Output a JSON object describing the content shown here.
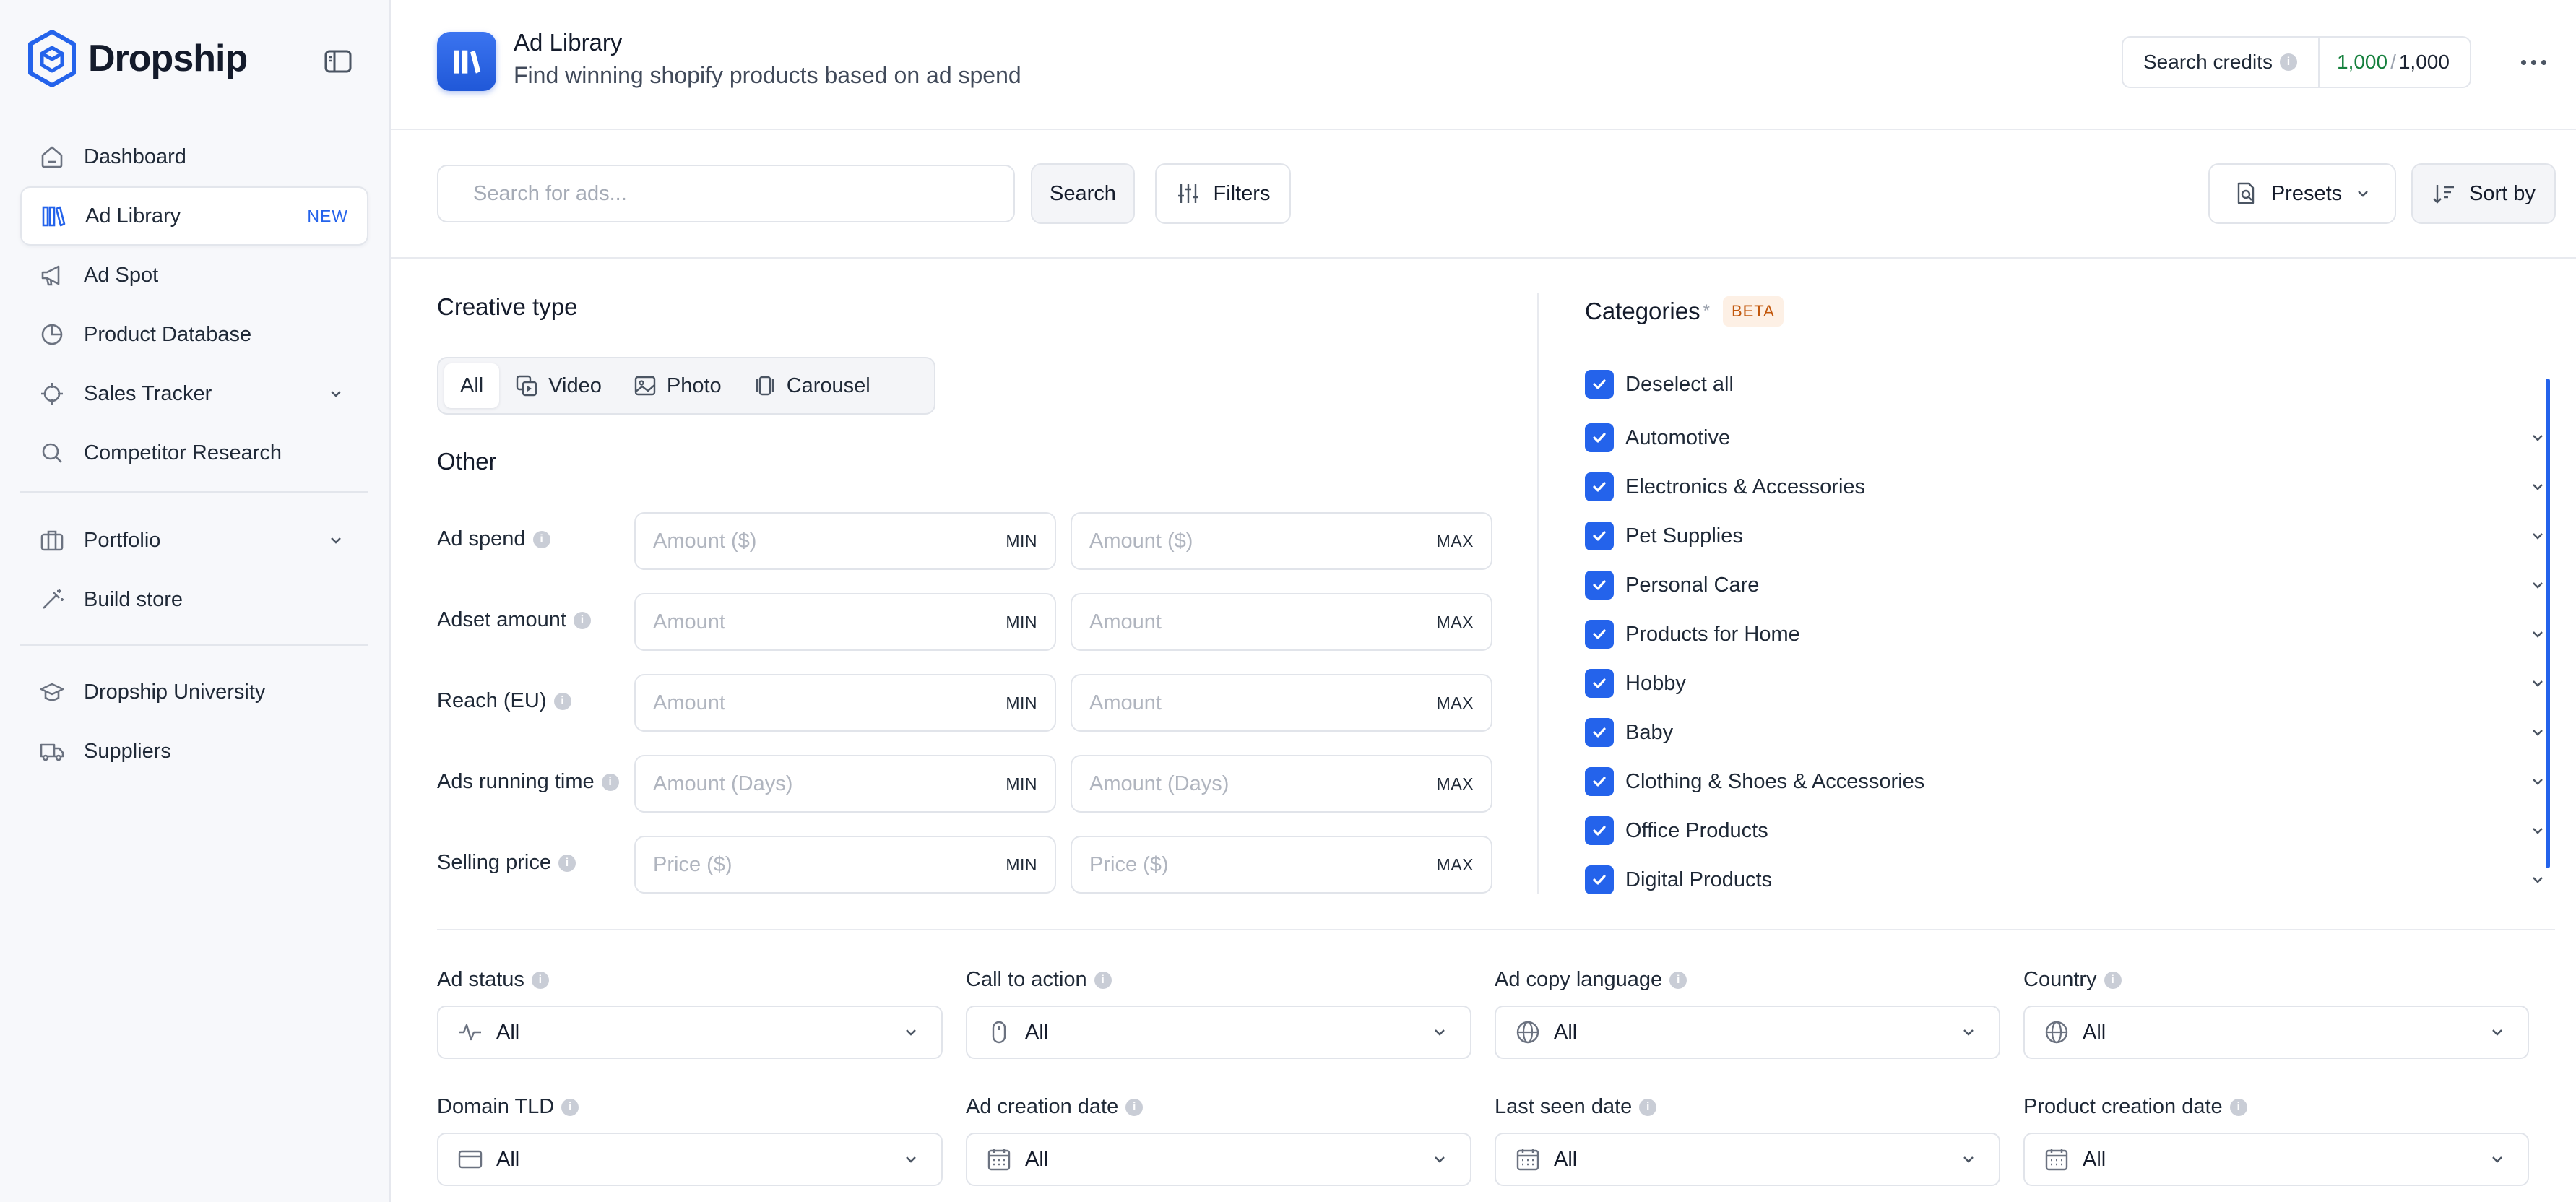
{
  "brand": {
    "name": "Dropship"
  },
  "sidebar": {
    "items": [
      {
        "label": "Dashboard",
        "icon": "home-icon"
      },
      {
        "label": "Ad Library",
        "icon": "library-icon",
        "badge": "NEW",
        "active": true
      },
      {
        "label": "Ad Spot",
        "icon": "megaphone-icon"
      },
      {
        "label": "Product Database",
        "icon": "pie-chart-icon"
      },
      {
        "label": "Sales Tracker",
        "icon": "crosshair-icon",
        "expandable": true
      },
      {
        "label": "Competitor Research",
        "icon": "search-icon"
      },
      {
        "label": "Portfolio",
        "icon": "briefcase-icon",
        "expandable": true
      },
      {
        "label": "Build store",
        "icon": "wand-icon"
      },
      {
        "label": "Dropship University",
        "icon": "graduation-cap-icon"
      },
      {
        "label": "Suppliers",
        "icon": "truck-icon"
      }
    ]
  },
  "header": {
    "title": "Ad Library",
    "subtitle": "Find winning shopify products based on ad spend",
    "credits_label": "Search credits",
    "credits_used": "1,000",
    "credits_total": "1,000"
  },
  "toolbar": {
    "search_placeholder": "Search for ads...",
    "search_label": "Search",
    "filters_label": "Filters",
    "presets_label": "Presets",
    "sort_label": "Sort by"
  },
  "creative": {
    "title": "Creative type",
    "options": [
      {
        "label": "All",
        "active": true
      },
      {
        "label": "Video",
        "icon": "video-icon"
      },
      {
        "label": "Photo",
        "icon": "image-icon"
      },
      {
        "label": "Carousel",
        "icon": "carousel-icon"
      }
    ]
  },
  "other": {
    "title": "Other",
    "min_tag": "MIN",
    "max_tag": "MAX",
    "ranges": [
      {
        "label": "Ad spend",
        "placeholder": "Amount ($)"
      },
      {
        "label": "Adset amount",
        "placeholder": "Amount"
      },
      {
        "label": "Reach (EU)",
        "placeholder": "Amount"
      },
      {
        "label": "Ads running time",
        "placeholder": "Amount (Days)"
      },
      {
        "label": "Selling price",
        "placeholder": "Price ($)"
      }
    ]
  },
  "categories": {
    "title": "Categories",
    "required_mark": "*",
    "badge": "BETA",
    "deselect_label": "Deselect all",
    "items": [
      "Automotive",
      "Electronics & Accessories",
      "Pet Supplies",
      "Personal Care",
      "Products for Home",
      "Hobby",
      "Baby",
      "Clothing & Shoes & Accessories",
      "Office Products",
      "Digital Products"
    ]
  },
  "dropdowns": [
    {
      "label": "Ad status",
      "value": "All",
      "icon": "activity-icon"
    },
    {
      "label": "Call to action",
      "value": "All",
      "icon": "mouse-icon"
    },
    {
      "label": "Ad copy language",
      "value": "All",
      "icon": "globe-icon"
    },
    {
      "label": "Country",
      "value": "All",
      "icon": "globe-icon"
    },
    {
      "label": "Domain TLD",
      "value": "All",
      "icon": "card-icon"
    },
    {
      "label": "Ad creation date",
      "value": "All",
      "icon": "calendar-icon"
    },
    {
      "label": "Last seen date",
      "value": "All",
      "icon": "calendar-icon"
    },
    {
      "label": "Product creation date",
      "value": "All",
      "icon": "calendar-icon"
    }
  ],
  "colors": {
    "accent": "#2463eb",
    "credits_used": "#15803d",
    "beta_text": "#c2570c",
    "beta_bg": "#fdf0e5"
  }
}
